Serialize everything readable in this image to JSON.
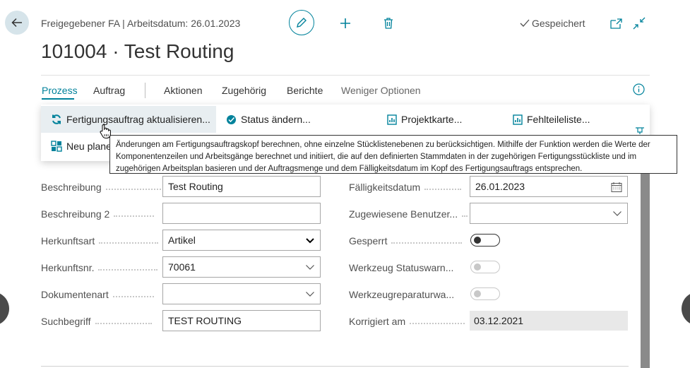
{
  "header": {
    "context": "Freigegebener FA | Arbeitsdatum: 26.01.2023",
    "title": "101004 · Test Routing",
    "saved_label": "Gespeichert"
  },
  "nav": {
    "prozess": "Prozess",
    "auftrag": "Auftrag",
    "aktionen": "Aktionen",
    "zugehoerig": "Zugehörig",
    "berichte": "Berichte",
    "weniger": "Weniger Optionen"
  },
  "actions": {
    "update_order": "Fertigungsauftrag aktualisieren...",
    "change_status": "Status ändern...",
    "project_card": "Projektkarte...",
    "shortage_list": "Fehlteileliste...",
    "replan": "Neu plane"
  },
  "tooltip": {
    "text": "Änderungen am Fertigungsauftragskopf berechnen, ohne einzelne Stücklistenebenen zu berücksichtigen. Mithilfe der Funktion werden die Werte der Komponentenzeilen und Arbeitsgänge berechnet und initiiert, die auf den definierten Stammdaten in der zugehörigen Fertigungsstückliste und im zugehörigen Arbeitsplan basieren und der Auftragsmenge und dem Fälligkeitsdatum im Kopf des Fertigungsauftrags entsprechen."
  },
  "form": {
    "left": {
      "beschreibung_label": "Beschreibung",
      "beschreibung_value": "Test Routing",
      "beschreibung2_label": "Beschreibung 2",
      "beschreibung2_value": "",
      "herkunftsart_label": "Herkunftsart",
      "herkunftsart_value": "Artikel",
      "herkunftsnr_label": "Herkunftsnr.",
      "herkunftsnr_value": "70061",
      "dokumentenart_label": "Dokumentenart",
      "dokumentenart_value": "",
      "suchbegriff_label": "Suchbegriff",
      "suchbegriff_value": "TEST ROUTING"
    },
    "right": {
      "faelligkeit_label": "Fälligkeitsdatum",
      "faelligkeit_value": "26.01.2023",
      "benutzer_label": "Zugewiesene Benutzer...",
      "benutzer_value": "",
      "gesperrt_label": "Gesperrt",
      "gesperrt_on": false,
      "werkzeug_status_label": "Werkzeug Statuswarn...",
      "werkzeug_reparatur_label": "Werkzeugreparaturwa...",
      "korrigiert_label": "Korrigiert am",
      "korrigiert_value": "03.12.2021"
    }
  },
  "colors": {
    "accent": "#00829b",
    "hover": "#e8eef1",
    "readonly_bg": "#e8e8e8"
  }
}
